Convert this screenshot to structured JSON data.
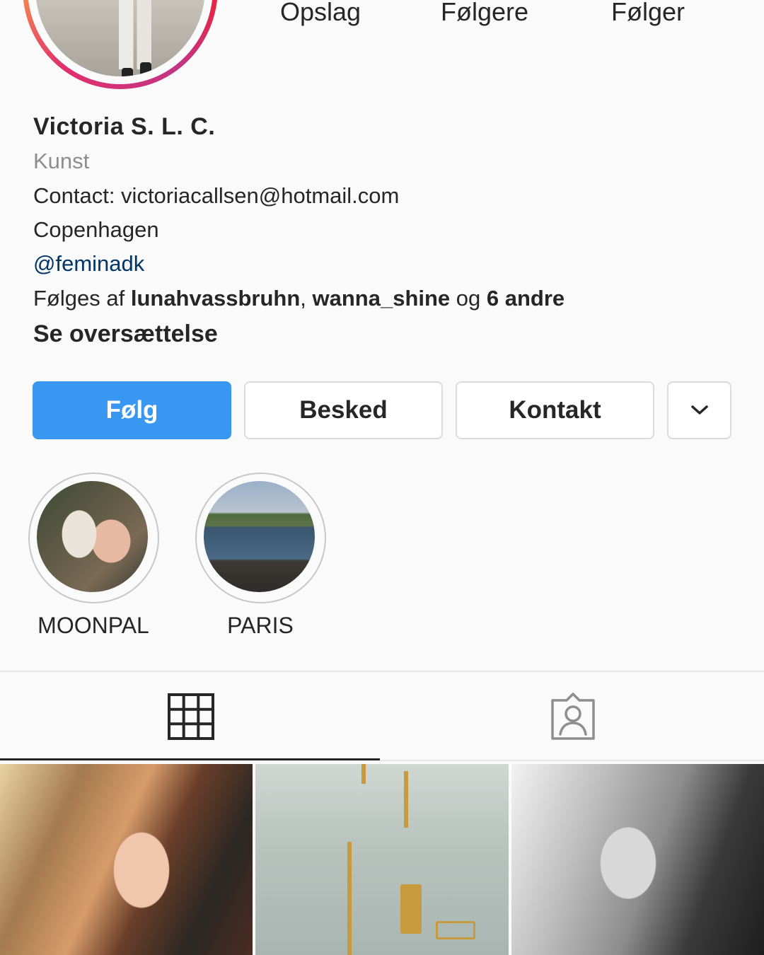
{
  "stats": {
    "posts_label": "Opslag",
    "followers_label": "Følgere",
    "following_label": "Følger"
  },
  "profile": {
    "name": "Victoria S. L. C.",
    "category": "Kunst",
    "contact": "Contact: victoriacallsen@hotmail.com",
    "city": "Copenhagen",
    "mention": "@feminadk",
    "followed_by_prefix": "Følges af ",
    "followed_by_user1": "lunahvassbruhn",
    "followed_by_sep": ", ",
    "followed_by_user2": "wanna_shine",
    "followed_by_and": " og ",
    "followed_by_others": "6 andre",
    "see_translation": "Se oversættelse"
  },
  "actions": {
    "follow": "Følg",
    "message": "Besked",
    "contact": "Kontakt"
  },
  "highlights": [
    {
      "label": "MOONPAL"
    },
    {
      "label": "PARIS"
    }
  ],
  "tabs": {
    "active": "grid"
  },
  "colors": {
    "accent": "#3897f0",
    "mention": "#003569",
    "secondary_text": "#8e8e8e"
  }
}
